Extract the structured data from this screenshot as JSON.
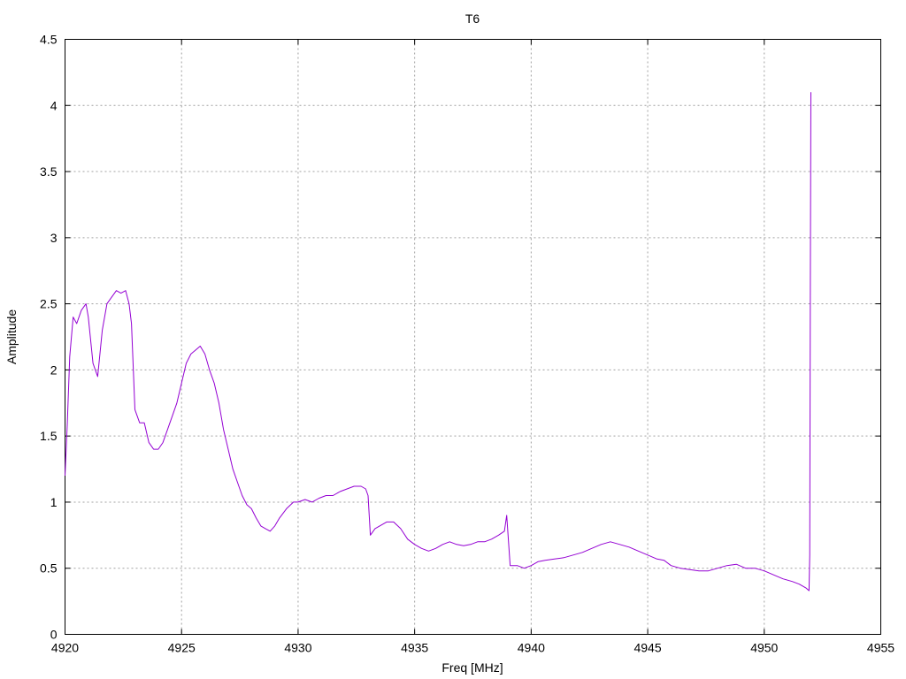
{
  "chart_data": {
    "type": "line",
    "title": "T6",
    "xlabel": "Freq [MHz]",
    "ylabel": "Amplitude",
    "xlim": [
      4920,
      4955
    ],
    "ylim": [
      0,
      4.5
    ],
    "x_ticks": [
      4920,
      4925,
      4930,
      4935,
      4940,
      4945,
      4950,
      4955
    ],
    "x_tick_labels": [
      "4920",
      "4925",
      "4930",
      "4935",
      "4940",
      "4945",
      "4950",
      "4955"
    ],
    "y_ticks": [
      0,
      0.5,
      1,
      1.5,
      2,
      2.5,
      3,
      3.5,
      4,
      4.5
    ],
    "y_tick_labels": [
      "0",
      "0.5",
      "1",
      "1.5",
      "2",
      "2.5",
      "3",
      "3.5",
      "4",
      "4.5"
    ],
    "grid": true,
    "legend": "none",
    "series_color": "#9400d3",
    "series": [
      {
        "x": [
          4920.0,
          4920.1,
          4920.2,
          4920.35,
          4920.5,
          4920.7,
          4920.9,
          4921.0,
          4921.2,
          4921.4,
          4921.6,
          4921.8,
          4922.0,
          4922.2,
          4922.4,
          4922.6,
          4922.75,
          4922.85,
          4923.0,
          4923.2,
          4923.4,
          4923.6,
          4923.8,
          4924.0,
          4924.2,
          4924.4,
          4924.6,
          4924.8,
          4925.0,
          4925.2,
          4925.4,
          4925.6,
          4925.8,
          4926.0,
          4926.2,
          4926.4,
          4926.6,
          4926.8,
          4927.0,
          4927.2,
          4927.4,
          4927.6,
          4927.8,
          4928.0,
          4928.2,
          4928.4,
          4928.6,
          4928.8,
          4929.0,
          4929.2,
          4929.5,
          4929.8,
          4930.0,
          4930.3,
          4930.6,
          4930.9,
          4931.2,
          4931.5,
          4931.8,
          4932.1,
          4932.4,
          4932.7,
          4932.9,
          4933.0,
          4933.1,
          4933.3,
          4933.5,
          4933.8,
          4934.1,
          4934.4,
          4934.7,
          4935.0,
          4935.3,
          4935.6,
          4935.9,
          4936.2,
          4936.5,
          4936.8,
          4937.1,
          4937.4,
          4937.7,
          4938.0,
          4938.3,
          4938.6,
          4938.85,
          4938.95,
          4939.1,
          4939.4,
          4939.7,
          4940.0,
          4940.3,
          4940.6,
          4941.0,
          4941.4,
          4941.8,
          4942.2,
          4942.6,
          4943.0,
          4943.4,
          4943.8,
          4944.2,
          4944.6,
          4945.0,
          4945.4,
          4945.7,
          4946.0,
          4946.4,
          4946.8,
          4947.2,
          4947.6,
          4948.0,
          4948.4,
          4948.8,
          4949.2,
          4949.6,
          4950.0,
          4950.4,
          4950.8,
          4951.2,
          4951.5,
          4951.8,
          4951.92,
          4951.95,
          4951.98,
          4952.0
        ],
        "y": [
          1.2,
          1.6,
          2.1,
          2.4,
          2.35,
          2.45,
          2.5,
          2.4,
          2.05,
          1.95,
          2.3,
          2.5,
          2.55,
          2.6,
          2.58,
          2.6,
          2.5,
          2.35,
          1.7,
          1.6,
          1.6,
          1.45,
          1.4,
          1.4,
          1.45,
          1.55,
          1.65,
          1.75,
          1.9,
          2.05,
          2.12,
          2.15,
          2.18,
          2.12,
          2.0,
          1.9,
          1.75,
          1.55,
          1.4,
          1.25,
          1.15,
          1.05,
          0.98,
          0.95,
          0.88,
          0.82,
          0.8,
          0.78,
          0.82,
          0.88,
          0.95,
          1.0,
          1.0,
          1.02,
          1.0,
          1.03,
          1.05,
          1.05,
          1.08,
          1.1,
          1.12,
          1.12,
          1.1,
          1.05,
          0.75,
          0.8,
          0.82,
          0.85,
          0.85,
          0.8,
          0.72,
          0.68,
          0.65,
          0.63,
          0.65,
          0.68,
          0.7,
          0.68,
          0.67,
          0.68,
          0.7,
          0.7,
          0.72,
          0.75,
          0.78,
          0.9,
          0.52,
          0.52,
          0.5,
          0.52,
          0.55,
          0.56,
          0.57,
          0.58,
          0.6,
          0.62,
          0.65,
          0.68,
          0.7,
          0.68,
          0.66,
          0.63,
          0.6,
          0.57,
          0.56,
          0.52,
          0.5,
          0.49,
          0.48,
          0.48,
          0.5,
          0.52,
          0.53,
          0.5,
          0.5,
          0.48,
          0.45,
          0.42,
          0.4,
          0.38,
          0.35,
          0.33,
          0.6,
          2.7,
          4.1
        ]
      }
    ]
  }
}
